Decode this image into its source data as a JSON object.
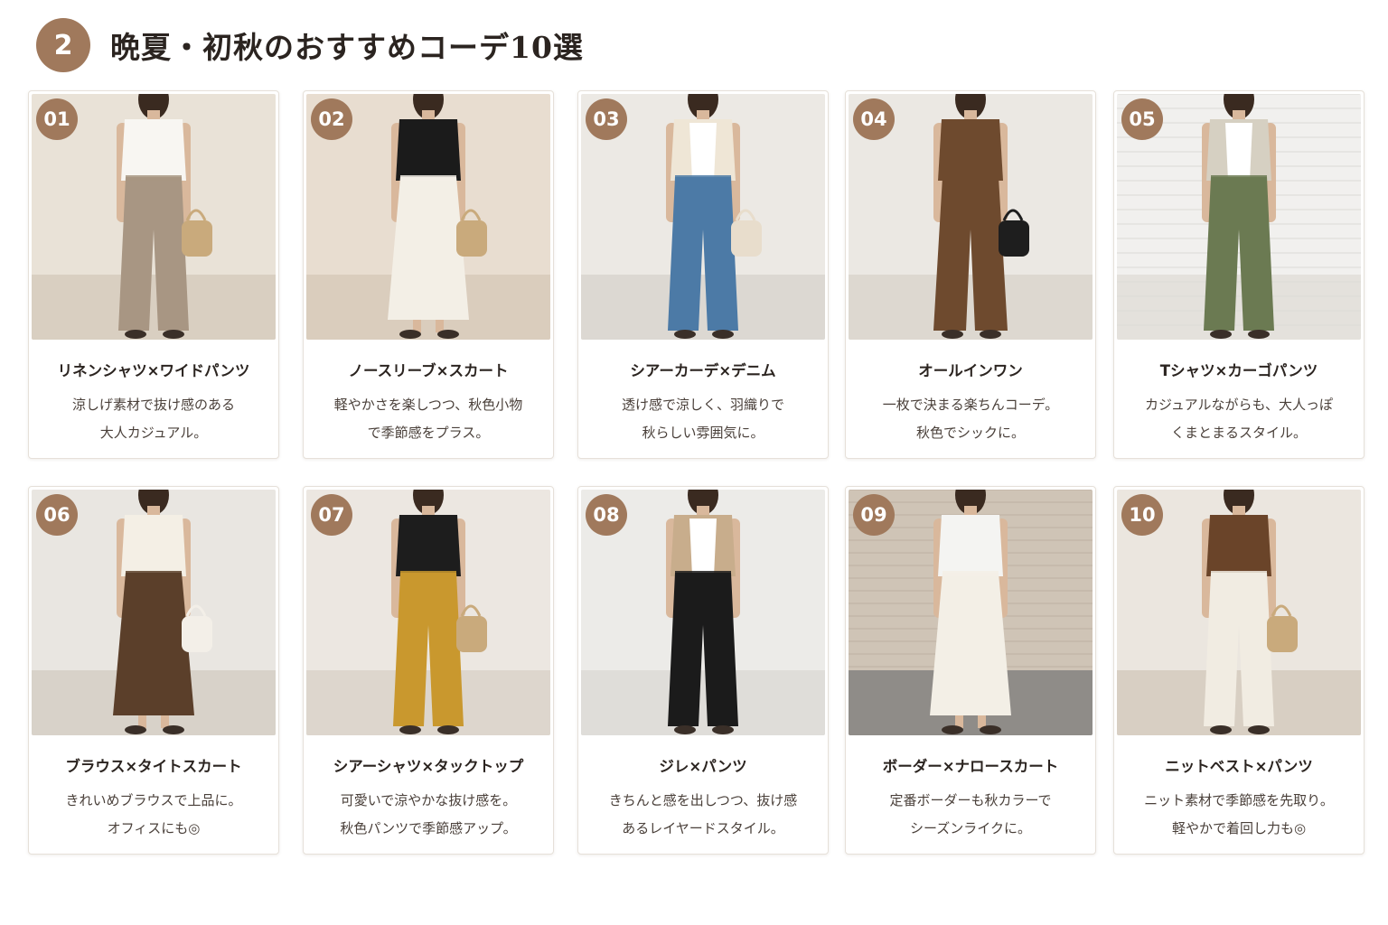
{
  "section": {
    "number": "2",
    "title": "晩夏・初秋のおすすめコーデ10選"
  },
  "colors": {
    "accent": "#a0795c"
  },
  "cards": [
    {
      "num": "01",
      "title": "リネンシャツ×ワイドパンツ",
      "desc": [
        "涼しげ素材で抜け感のある",
        "大人カジュアル。"
      ],
      "image": "photo-linen-shirt-wide-pants",
      "bg": "#e9e2d7",
      "floor": "#d9cfc1",
      "top": "#f8f6f2",
      "bottom": "#a89683",
      "bag": "#c9aa7c",
      "inner": "#f8f6f2"
    },
    {
      "num": "02",
      "title": "ノースリーブ×スカート",
      "desc": [
        "軽やかさを楽しつつ、秋色小物",
        "で季節感をプラス。"
      ],
      "image": "photo-sleeveless-skirt",
      "bg": "#e8ddd0",
      "floor": "#dacdbd",
      "top": "#1b1b1b",
      "bottom": "#f3efe6",
      "bag": "#c9aa7c",
      "inner": "#1b1b1b"
    },
    {
      "num": "03",
      "title": "シアーカーデ×デニム",
      "desc": [
        "透け感で涼しく、羽織りで",
        "秋らしい雰囲気に。"
      ],
      "image": "photo-sheer-cardigan-denim",
      "bg": "#ece9e4",
      "floor": "#dcd8d2",
      "top": "#efe6d6",
      "bottom": "#4c7aa6",
      "bag": "#e8ddcc",
      "inner": "#ffffff"
    },
    {
      "num": "04",
      "title": "オールインワン",
      "desc": [
        "一枚で決まる楽ちんコーデ。",
        "秋色でシックに。"
      ],
      "image": "photo-all-in-one",
      "bg": "#ebe8e3",
      "floor": "#ddd8d0",
      "top": "#6e4a2e",
      "bottom": "#6e4a2e",
      "bag": "#1e1e1e",
      "inner": "#6e4a2e"
    },
    {
      "num": "05",
      "title": "Tシャツ×カーゴパンツ",
      "desc": [
        "カジュアルながらも、大人っぽ",
        "くまとまるスタイル。"
      ],
      "image": "photo-tshirt-cargo-pants",
      "bg": "#f1f0ee",
      "floor": "#e4e1dc",
      "top": "#d6d0c2",
      "bottom": "#6b7a52",
      "bag": "",
      "inner": "#ffffff"
    },
    {
      "num": "06",
      "title": "ブラウス×タイトスカート",
      "desc": [
        "きれいめブラウスで上品に。",
        "オフィスにも◎"
      ],
      "image": "photo-blouse-tight-skirt",
      "bg": "#e9e6e1",
      "floor": "#d8d2c9",
      "top": "#f4efe5",
      "bottom": "#5b3f2a",
      "bag": "#f3efe8",
      "inner": "#f4efe5"
    },
    {
      "num": "07",
      "title": "シアーシャツ×タックトップ",
      "desc": [
        "可愛いで涼やかな抜け感を。",
        "秋色パンツで季節感アップ。"
      ],
      "image": "photo-sheer-shirt-tuck",
      "bg": "#ece7e1",
      "floor": "#ddd6cd",
      "top": "#1d1d1d",
      "bottom": "#c9982e",
      "bag": "#c9aa7c",
      "inner": "#1d1d1d"
    },
    {
      "num": "08",
      "title": "ジレ×パンツ",
      "desc": [
        "きちんと感を出しつつ、抜け感",
        "あるレイヤードスタイル。"
      ],
      "image": "photo-gilet-pants",
      "bg": "#ecebe8",
      "floor": "#dfddd9",
      "top": "#c8ad8c",
      "bottom": "#1b1b1b",
      "bag": "",
      "inner": "#ffffff"
    },
    {
      "num": "09",
      "title": "ボーダー×ナロースカート",
      "desc": [
        "定番ボーダーも秋カラーで",
        "シーズンライクに。"
      ],
      "image": "photo-border-narrow-skirt",
      "bg": "#cfc4b6",
      "floor": "#8f8c88",
      "top": "#f4f4f2",
      "bottom": "#f3efe6",
      "bag": "",
      "inner": "#f4f4f2"
    },
    {
      "num": "10",
      "title": "ニットベスト×パンツ",
      "desc": [
        "ニット素材で季節感を先取り。",
        "軽やかで着回し力も◎"
      ],
      "image": "photo-knit-vest-pants",
      "bg": "#ebe6df",
      "floor": "#d8cfc3",
      "top": "#6a4429",
      "bottom": "#f1ece2",
      "bag": "#c9aa7c",
      "inner": "#6a4429"
    }
  ]
}
